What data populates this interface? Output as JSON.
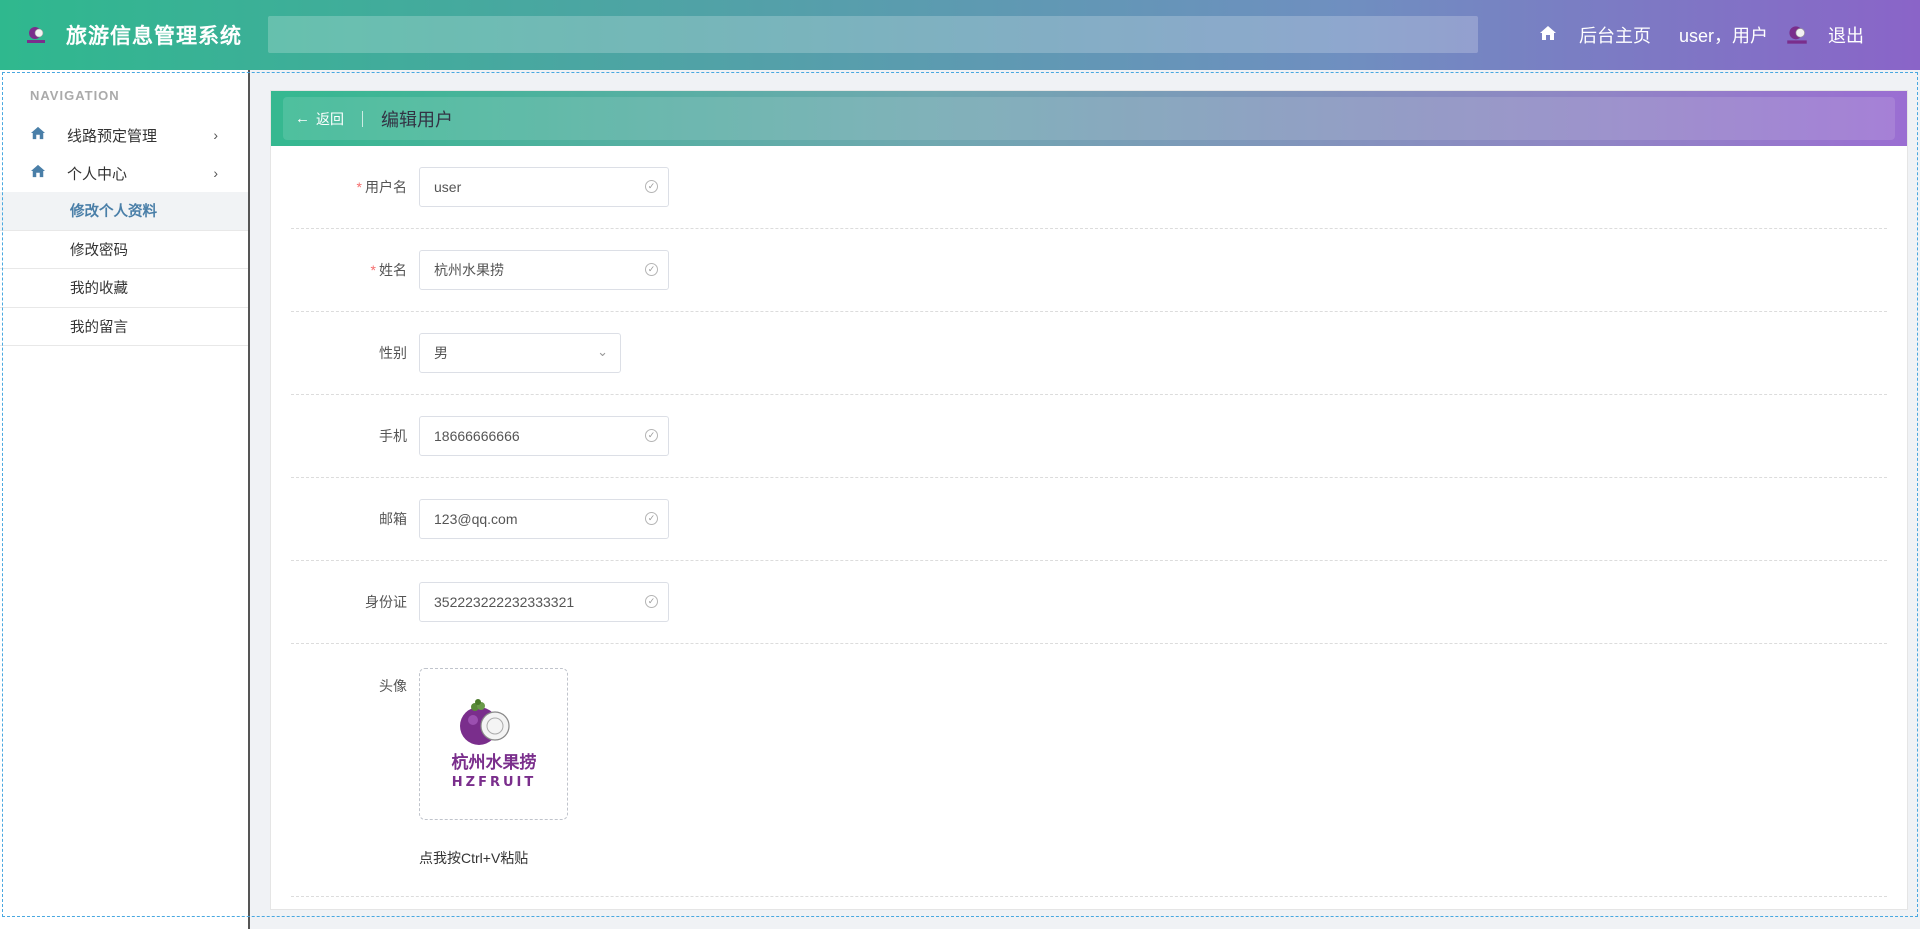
{
  "header": {
    "app_title": "旅游信息管理系统",
    "home_link": "后台主页",
    "user_label": "user，用户",
    "logout": "退出"
  },
  "sidebar": {
    "heading": "NAVIGATION",
    "items": [
      {
        "label": "线路预定管理",
        "icon": "home-icon"
      },
      {
        "label": "个人中心",
        "icon": "home-icon"
      }
    ],
    "sub_items": [
      {
        "label": "修改个人资料",
        "active": true
      },
      {
        "label": "修改密码"
      },
      {
        "label": "我的收藏"
      },
      {
        "label": "我的留言"
      }
    ]
  },
  "panel": {
    "back": "返回",
    "title": "编辑用户"
  },
  "form": {
    "username": {
      "label": "用户名",
      "value": "user",
      "required": true
    },
    "name": {
      "label": "姓名",
      "value": "杭州水果捞",
      "required": true
    },
    "gender": {
      "label": "性别",
      "value": "男"
    },
    "phone": {
      "label": "手机",
      "value": "18666666666"
    },
    "email": {
      "label": "邮箱",
      "value": "123@qq.com"
    },
    "id_card": {
      "label": "身份证",
      "value": "352223222232333321"
    },
    "avatar": {
      "label": "头像",
      "hint": "点我按Ctrl+V粘贴",
      "logo_text": "杭州水果捞",
      "logo_sub": "HZFRUIT"
    }
  },
  "colors": {
    "accent": "#4a7fa8",
    "required": "#f56c6c",
    "header_start": "#2fb88e",
    "header_end": "#8a64c8"
  }
}
